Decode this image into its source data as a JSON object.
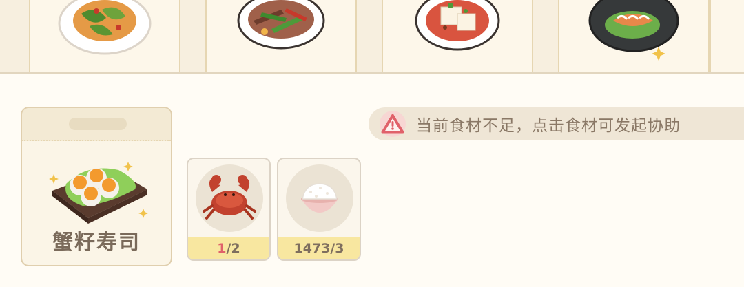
{
  "dishes": [
    {
      "name": "虎皮青椒",
      "icon": "pepper-dish-icon"
    },
    {
      "name": "青椒肉丝",
      "icon": "pepper-pork-dish-icon"
    },
    {
      "name": "麻婆豆腐",
      "icon": "tofu-dish-icon"
    },
    {
      "name": "盐焗虾",
      "icon": "shrimp-dish-icon"
    }
  ],
  "recipe": {
    "name": "蟹籽寿司",
    "icon": "roe-sushi-icon"
  },
  "notice": {
    "text": "当前食材不足，点击食材可发起协助",
    "icon": "warning-icon",
    "color": "#e0616a"
  },
  "ingredients": [
    {
      "icon": "crab-icon",
      "have": "1",
      "need": "/2",
      "sufficient": false
    },
    {
      "icon": "rice-bowl-icon",
      "have": "1473",
      "need": "/3",
      "sufficient": true
    }
  ],
  "colors": {
    "accent_warning": "#e0616a",
    "count_bar": "#f8e7a0",
    "card_bg": "#fbf5e7"
  }
}
